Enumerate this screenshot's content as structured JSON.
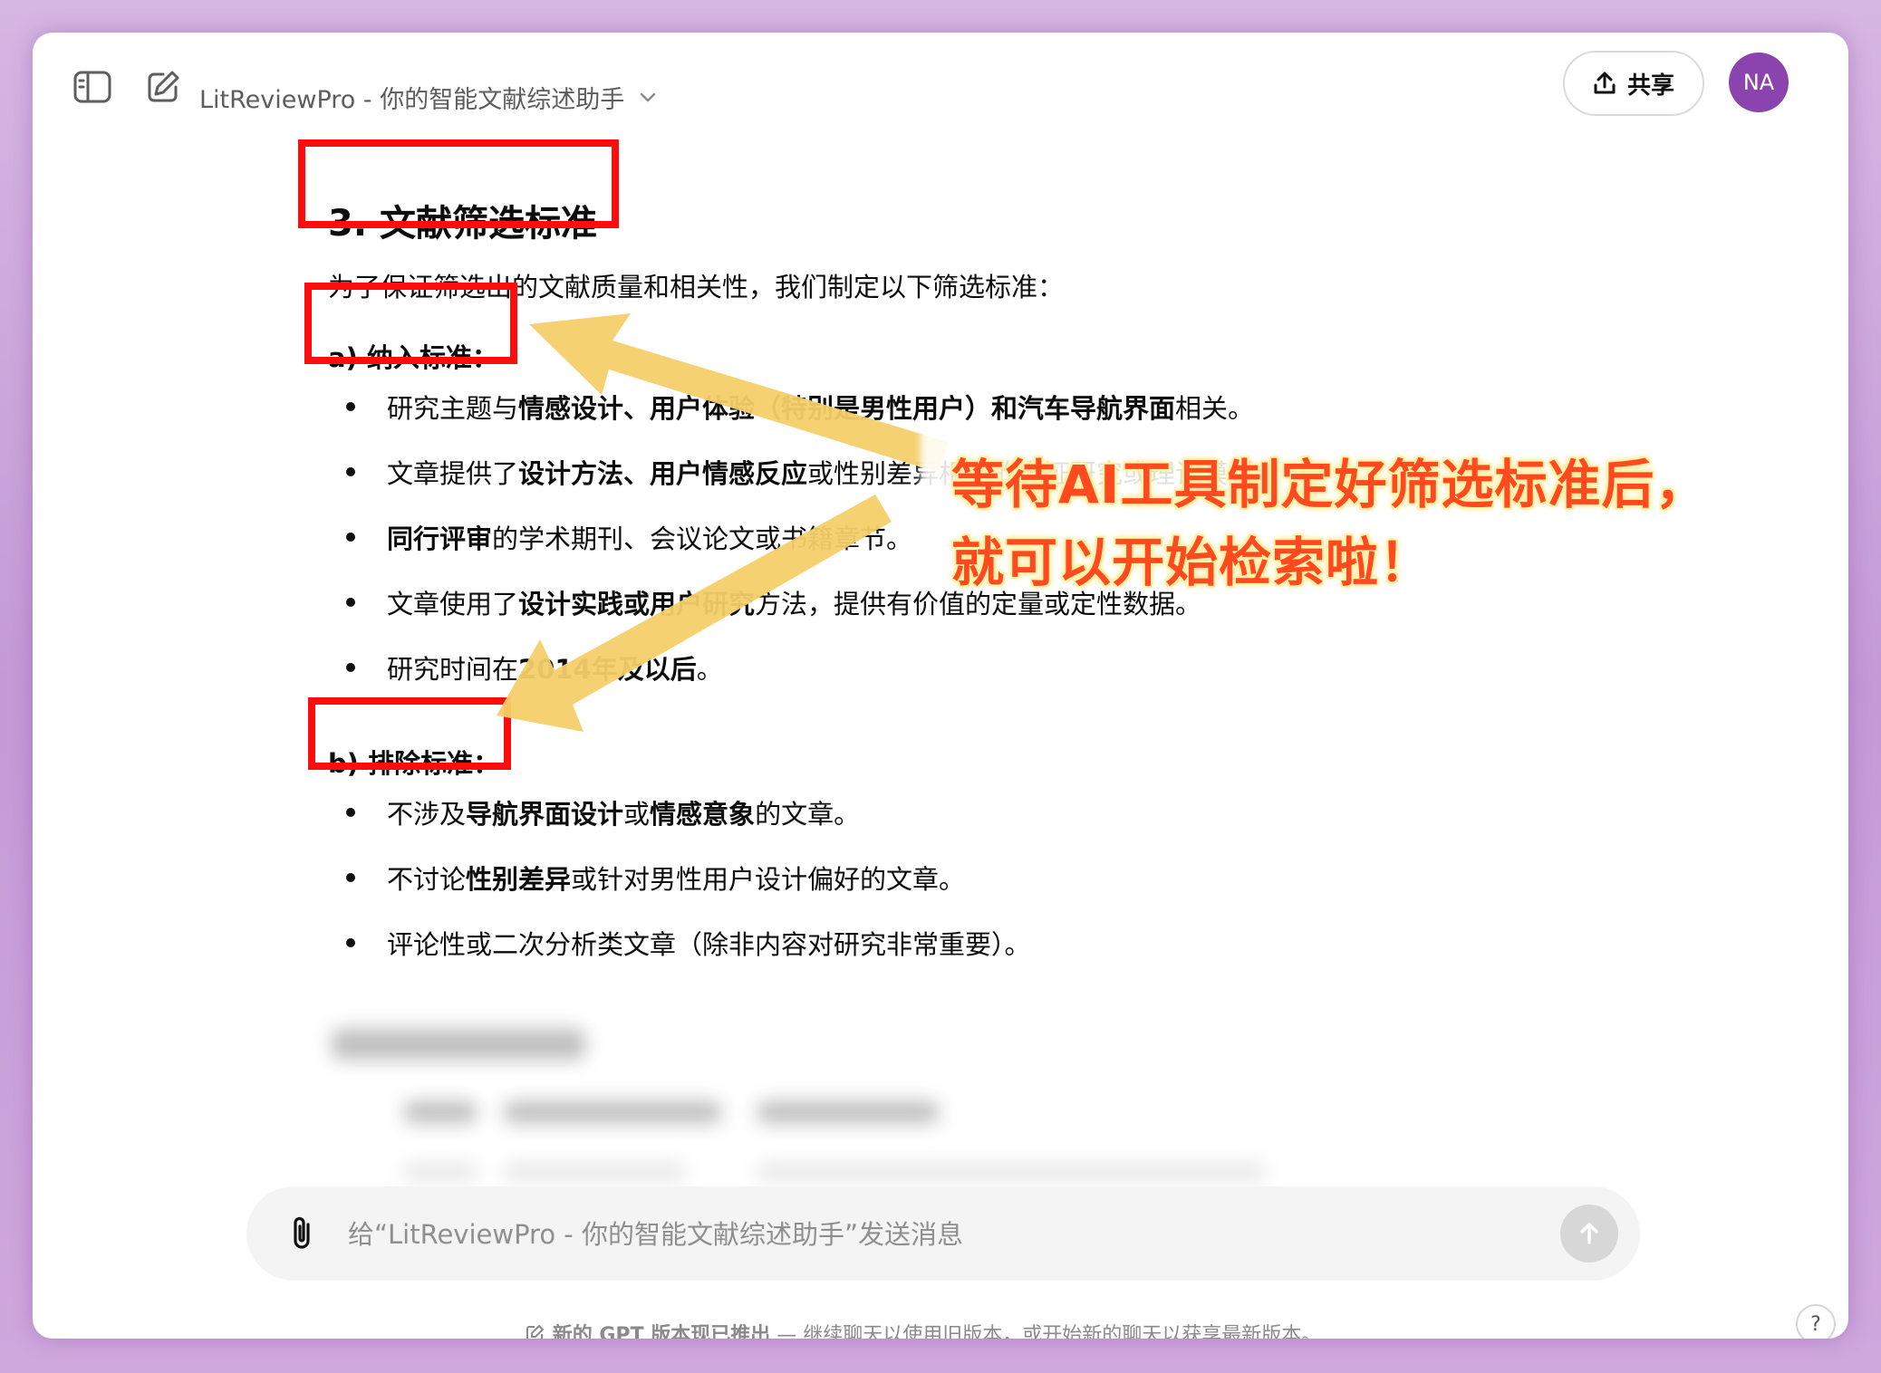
{
  "header": {
    "model_name": "LitReviewPro - 你的智能文献综述助手",
    "share_label": "共享",
    "avatar_initials": "NA"
  },
  "section": {
    "heading": "3. 文献筛选标准",
    "intro": "为了保证筛选出的文献质量和相关性，我们制定以下筛选标准：",
    "inclusion": {
      "title": "a) 纳入标准：",
      "items": [
        {
          "pre": "研究主题与",
          "bold": "情感设计、用户体验（特别是男性用户）和汽车导航界面",
          "post": "相关。"
        },
        {
          "pre": "文章提供了",
          "bold": "设计方法、用户情感反应",
          "post": "或性别差异相关的实证研究或理论模型。"
        },
        {
          "pre": "",
          "bold": "同行评审",
          "post": "的学术期刊、会议论文或书籍章节。"
        },
        {
          "pre": "文章使用了",
          "bold": "设计实践或用户研究",
          "post": "方法，提供有价值的定量或定性数据。"
        },
        {
          "pre": "研究时间在",
          "bold": "2014年及以后",
          "post": "。"
        }
      ]
    },
    "exclusion": {
      "title": "b) 排除标准：",
      "items": [
        {
          "pre": "不涉及",
          "bold": "导航界面设计",
          "mid": "或",
          "bold2": "情感意象",
          "post": "的文章。"
        },
        {
          "pre": "不讨论",
          "bold": "性别差异",
          "post": "或针对男性用户设计偏好的文章。"
        },
        {
          "pre": "评论性或二次分析类文章（除非内容对研究非常重要）。",
          "bold": "",
          "post": ""
        }
      ]
    }
  },
  "annotation": {
    "line1": "等待AI工具制定好筛选标准后，",
    "line2": "就可以开始检索啦！"
  },
  "composer": {
    "placeholder": "给“LitReviewPro - 你的智能文献综述助手”发送消息"
  },
  "footer": {
    "bold": "新的 GPT 版本现已推出",
    "text1": " — 继续聊天以使用旧版本，或开始",
    "link": "新的聊天",
    "text2": "以获享最新版本。",
    "help": "?"
  },
  "colors": {
    "highlight_box": "#ff0d0d",
    "arrow": "#f6cf6a",
    "annotation_text": "#ff4a1f",
    "avatar_bg": "#8b44ad"
  }
}
